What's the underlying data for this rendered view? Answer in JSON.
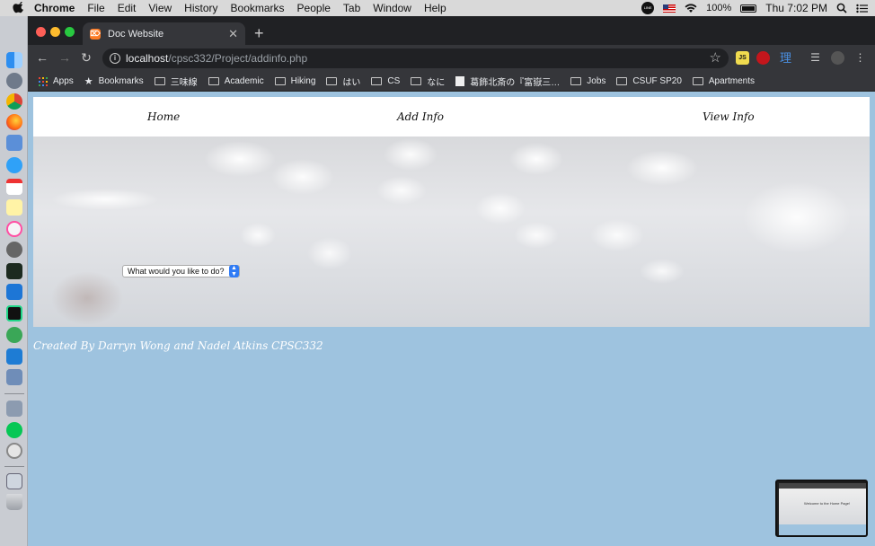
{
  "menubar": {
    "app": "Chrome",
    "items": [
      "File",
      "Edit",
      "View",
      "History",
      "Bookmarks",
      "People",
      "Tab",
      "Window",
      "Help"
    ],
    "line_icon": "LINE",
    "battery": "100%",
    "datetime": "Thu 7:02 PM"
  },
  "browser": {
    "tab_title": "Doc Website",
    "url_host": "localhost",
    "url_path": "/cpsc332/Project/addinfo.php",
    "bookmarks": [
      "Apps",
      "Bookmarks",
      "三味線",
      "Academic",
      "Hiking",
      "はい",
      "CS",
      "なに",
      "葛飾北斎の『富嶽三…",
      "Jobs",
      "CSUF SP20",
      "Apartments"
    ],
    "ext_js": "JS",
    "ext_kanji": "理"
  },
  "page": {
    "nav": {
      "home": "Home",
      "add": "Add Info",
      "view": "View Info"
    },
    "dropdown": {
      "selected": "What would you like to do?"
    },
    "footer": "Created By Darryn Wong and Nadel Atkins CPSC332",
    "thumbnail_text": "Welcome to the Home Page!"
  },
  "colors": {
    "page_background": "#9ec3df",
    "tabstrip": "#202124",
    "toolbar": "#35363a",
    "select_arrow": "#2f7bf5"
  }
}
